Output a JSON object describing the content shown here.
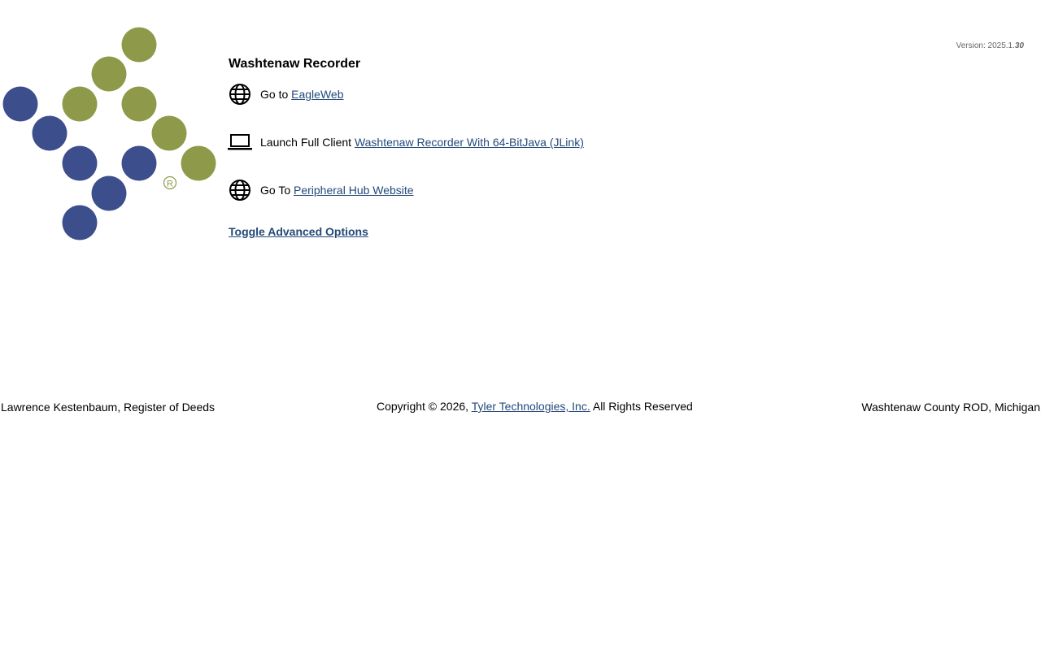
{
  "app": {
    "title": "Washtenaw Recorder",
    "version_label": "Version: 2025.1.",
    "version_suffix": "30"
  },
  "logo": {
    "blue": "#3d4e8c",
    "green": "#8e9a49",
    "registered_mark": "®"
  },
  "options": [
    {
      "icon": "globe-icon",
      "prefix": "Go to ",
      "link": "EagleWeb"
    },
    {
      "icon": "laptop-icon",
      "prefix": "Launch Full Client ",
      "link": "Washtenaw Recorder With 64-BitJava (JLink)"
    },
    {
      "icon": "globe-icon",
      "prefix": "Go To ",
      "link": "Peripheral Hub Website"
    }
  ],
  "toggle_advanced": "Toggle Advanced Options",
  "footer": {
    "left": "Lawrence Kestenbaum, Register of Deeds",
    "copyright_prefix": "Copyright © 2026, ",
    "company_link": "Tyler Technologies, Inc.",
    "copyright_suffix": " All Rights Reserved",
    "right": "Washtenaw County ROD, Michigan"
  },
  "colors": {
    "link": "#23497a",
    "version_text": "#666666"
  }
}
